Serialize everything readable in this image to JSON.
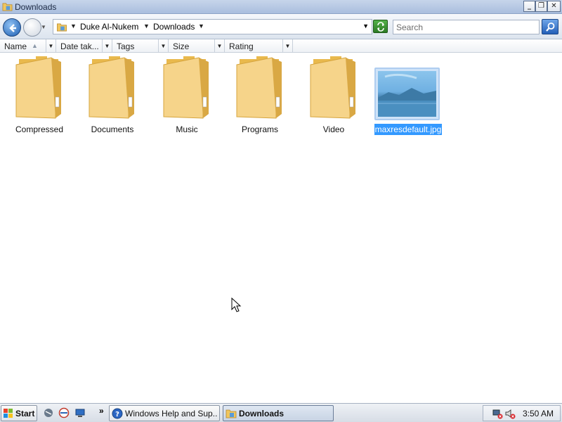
{
  "window": {
    "title": "Downloads",
    "minimize_icon": "minimize-icon",
    "maximize_icon": "restore-icon",
    "close_icon": "close-icon"
  },
  "address": {
    "path": [
      "Duke Al-Nukem",
      "Downloads"
    ],
    "search_placeholder": "Search"
  },
  "columns": [
    {
      "label": "Name",
      "sorted": "ascending"
    },
    {
      "label": "Date tak..."
    },
    {
      "label": "Tags"
    },
    {
      "label": "Size"
    },
    {
      "label": "Rating"
    }
  ],
  "items": [
    {
      "label": "Compressed",
      "type": "folder"
    },
    {
      "label": "Documents",
      "type": "folder"
    },
    {
      "label": "Music",
      "type": "folder"
    },
    {
      "label": "Programs",
      "type": "folder"
    },
    {
      "label": "Video",
      "type": "folder"
    },
    {
      "label": "maxresdefault.jpg",
      "type": "image",
      "selected": true
    }
  ],
  "taskbar": {
    "start_label": "Start",
    "more_label": "»",
    "tasks": [
      {
        "label": "Windows Help and Sup...",
        "icon": "help-icon",
        "active": false
      },
      {
        "label": "Downloads",
        "icon": "folder-icon",
        "active": true
      }
    ],
    "clock": "3:50 AM"
  },
  "colors": {
    "selection": "#3399ff",
    "titlebar": "#b6c7e3",
    "folder": "#f2c96b"
  }
}
